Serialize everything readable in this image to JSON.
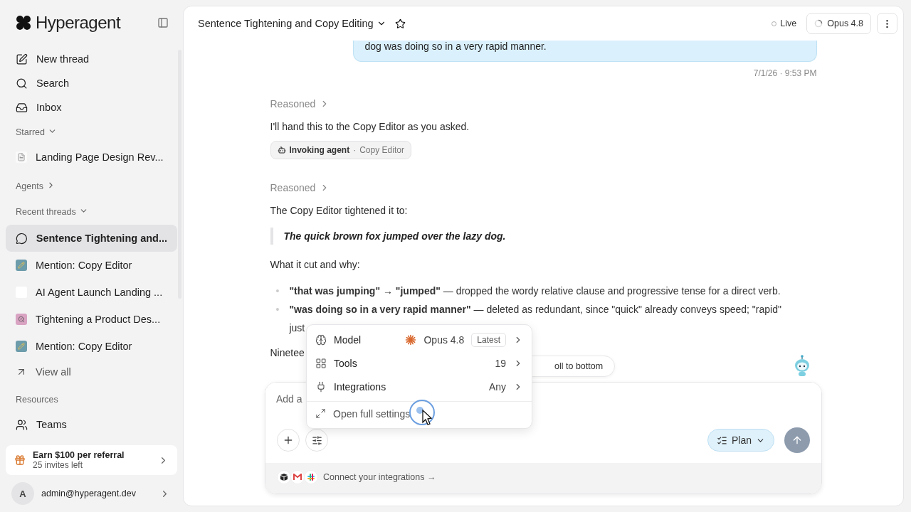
{
  "sidebar": {
    "brand": "Hyperagent",
    "nav": [
      {
        "label": "New thread",
        "kind": "edit"
      },
      {
        "label": "Search",
        "kind": "search"
      },
      {
        "label": "Inbox",
        "kind": "inbox"
      }
    ],
    "starred": {
      "title": "Starred",
      "expanded": true,
      "items": [
        {
          "label": "Landing Page Design Rev...",
          "kind": "doc"
        }
      ]
    },
    "agents": {
      "title": "Agents",
      "expanded": false
    },
    "recent": {
      "title": "Recent threads",
      "expanded": true,
      "items": [
        {
          "label": "Sentence Tightening and...",
          "kind": "chat",
          "selected": true
        },
        {
          "label": "Mention: Copy Editor",
          "kind": "pencil",
          "selected": false
        },
        {
          "label": "AI Agent Launch Landing ...",
          "kind": "blank",
          "selected": false
        },
        {
          "label": "Tightening a Product Des...",
          "kind": "magnifier",
          "selected": false
        },
        {
          "label": "Mention: Copy Editor",
          "kind": "pencil",
          "selected": false
        }
      ]
    },
    "view_all": "View all",
    "resources": {
      "title": "Resources",
      "items": [
        {
          "label": "Teams",
          "kind": "people"
        }
      ]
    },
    "referral": {
      "title": "Earn $100 per referral",
      "subtitle": "25 invites left"
    },
    "user": {
      "initial": "A",
      "email": "admin@hyperagent.dev"
    }
  },
  "header": {
    "title": "Sentence Tightening and Copy Editing",
    "starred": false,
    "live": "Live",
    "model": "Opus 4.8"
  },
  "messages": [
    {
      "kind": "user",
      "text": "dog was doing so in a very rapid manner.",
      "time": "7/1/26 · 9:53 PM"
    },
    {
      "kind": "reasoned",
      "text": "Reasoned"
    },
    {
      "kind": "text",
      "text": "I'll hand this to the Copy Editor as you asked."
    },
    {
      "kind": "agent",
      "label": "Invoking agent",
      "separator": "·",
      "agent": "Copy Editor"
    },
    {
      "kind": "reasoned",
      "text": "Reasoned"
    },
    {
      "kind": "text",
      "text": "The Copy Editor tightened it to:"
    },
    {
      "kind": "quote",
      "text": "The quick brown fox jumped over the lazy dog."
    },
    {
      "kind": "text",
      "text": "What it cut and why:"
    },
    {
      "kind": "bullets",
      "marker": "•",
      "items": [
        "**\"that was jumping\" → \"jumped\"** — dropped the wordy relative clause and progressive tense for a direct verb.",
        "**\"was doing so in a very rapid manner\"** — deleted as redundant, since \"quick\" already conveys speed; \"rapid\" just"
      ]
    },
    {
      "kind": "text",
      "text": "Ninetee"
    }
  ],
  "scroll_pill": "oll to bottom",
  "composer": {
    "placeholder": "Add a",
    "mode": "Plan",
    "connect": "Connect your integrations →"
  },
  "menu": {
    "items": [
      {
        "kind": "model",
        "label": "Model",
        "value": "Opus 4.8",
        "badge": "Latest"
      },
      {
        "kind": "tools",
        "label": "Tools",
        "value": "19"
      },
      {
        "kind": "integrations",
        "label": "Integrations",
        "value": "Any"
      }
    ],
    "footer": "Open full settings"
  }
}
